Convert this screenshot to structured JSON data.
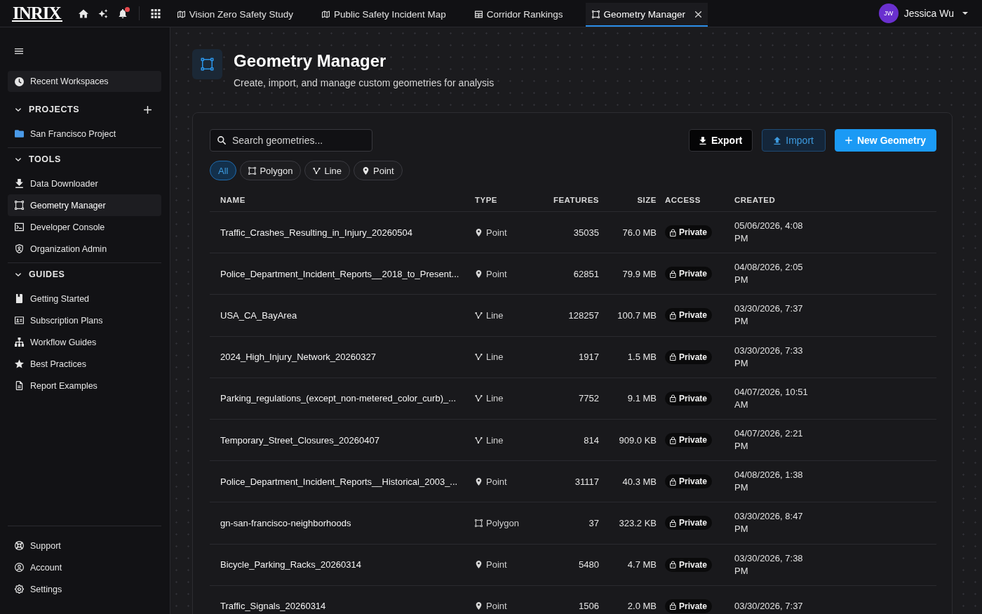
{
  "top_bar": {
    "logo": "INRIX",
    "notifications_unread": true,
    "tabs": [
      {
        "label": "Vision Zero Safety Study",
        "kind": "map",
        "selected": false,
        "closable": false
      },
      {
        "label": "Public Safety Incident Map",
        "kind": "map",
        "selected": false,
        "closable": false
      },
      {
        "label": "Corridor Rankings",
        "kind": "table",
        "selected": false,
        "closable": false
      },
      {
        "label": "Geometry Manager",
        "kind": "geometry",
        "selected": true,
        "closable": true
      }
    ],
    "user": {
      "initials": "JW",
      "name": "Jessica Wu"
    }
  },
  "sidebar": {
    "recent": {
      "label": "Recent Workspaces",
      "kind": "clock"
    },
    "sections": [
      {
        "title": "PROJECTS",
        "expanded": true,
        "add_button": true,
        "items": [
          {
            "label": "San Francisco Project",
            "kind": "folder",
            "selected": false
          }
        ]
      },
      {
        "title": "TOOLS",
        "expanded": true,
        "add_button": false,
        "items": [
          {
            "label": "Data Downloader",
            "kind": "download",
            "selected": false
          },
          {
            "label": "Geometry Manager",
            "kind": "geometry",
            "selected": true
          },
          {
            "label": "Developer Console",
            "kind": "terminal",
            "selected": false
          },
          {
            "label": "Organization Admin",
            "kind": "shield",
            "selected": false
          }
        ]
      },
      {
        "title": "GUIDES",
        "expanded": true,
        "add_button": false,
        "items": [
          {
            "label": "Getting Started",
            "kind": "book",
            "selected": false
          },
          {
            "label": "Subscription Plans",
            "kind": "card",
            "selected": false
          },
          {
            "label": "Workflow Guides",
            "kind": "hierarchy",
            "selected": false
          },
          {
            "label": "Best Practices",
            "kind": "star",
            "selected": false
          },
          {
            "label": "Report Examples",
            "kind": "document",
            "selected": false
          }
        ]
      }
    ],
    "footer_items": [
      {
        "label": "Support",
        "kind": "lifebuoy",
        "selected": false
      },
      {
        "label": "Account",
        "kind": "account",
        "selected": false
      },
      {
        "label": "Settings",
        "kind": "gear",
        "selected": false
      }
    ]
  },
  "header": {
    "title": "Geometry Manager",
    "subtitle": "Create, import, and manage custom geometries for analysis"
  },
  "toolbar": {
    "search": {
      "placeholder": "Search geometries..."
    },
    "buttons": [
      {
        "label": "Export",
        "kind": "export"
      },
      {
        "label": "Import",
        "kind": "import"
      },
      {
        "label": "New Geometry",
        "kind": "new"
      }
    ],
    "filters": [
      {
        "label": "All",
        "kind": "all",
        "selected": true
      },
      {
        "label": "Polygon",
        "kind": "polygon",
        "selected": false
      },
      {
        "label": "Line",
        "kind": "line",
        "selected": false
      },
      {
        "label": "Point",
        "kind": "point",
        "selected": false
      }
    ]
  },
  "table": {
    "columns": [
      "NAME",
      "TYPE",
      "FEATURES",
      "SIZE",
      "ACCESS",
      "CREATED"
    ],
    "rows": [
      {
        "name": "Traffic_Crashes_Resulting_in_Injury_20260504",
        "type": "Point",
        "kind": "point",
        "features": "35035",
        "size": "76.0 MB",
        "access": "Private",
        "created": "05/06/2026, 4:08 PM"
      },
      {
        "name": "Police_Department_Incident_Reports__2018_to_Present...",
        "type": "Point",
        "kind": "point",
        "features": "62851",
        "size": "79.9 MB",
        "access": "Private",
        "created": "04/08/2026, 2:05 PM"
      },
      {
        "name": "USA_CA_BayArea",
        "type": "Line",
        "kind": "line",
        "features": "128257",
        "size": "100.7 MB",
        "access": "Private",
        "created": "03/30/2026, 7:37 PM"
      },
      {
        "name": "2024_High_Injury_Network_20260327",
        "type": "Line",
        "kind": "line",
        "features": "1917",
        "size": "1.5 MB",
        "access": "Private",
        "created": "03/30/2026, 7:33 PM"
      },
      {
        "name": "Parking_regulations_(except_non-metered_color_curb)_...",
        "type": "Line",
        "kind": "line",
        "features": "7752",
        "size": "9.1 MB",
        "access": "Private",
        "created": "04/07/2026, 10:51 AM"
      },
      {
        "name": "Temporary_Street_Closures_20260407",
        "type": "Line",
        "kind": "line",
        "features": "814",
        "size": "909.0 KB",
        "access": "Private",
        "created": "04/07/2026, 2:21 PM"
      },
      {
        "name": "Police_Department_Incident_Reports__Historical_2003_...",
        "type": "Point",
        "kind": "point",
        "features": "31117",
        "size": "40.3 MB",
        "access": "Private",
        "created": "04/08/2026, 1:38 PM"
      },
      {
        "name": "gn-san-francisco-neighborhoods",
        "type": "Polygon",
        "kind": "polygon",
        "features": "37",
        "size": "323.2 KB",
        "access": "Private",
        "created": "03/30/2026, 8:47 PM"
      },
      {
        "name": "Bicycle_Parking_Racks_20260314",
        "type": "Point",
        "kind": "point",
        "features": "5480",
        "size": "4.7 MB",
        "access": "Private",
        "created": "03/30/2026, 7:38 PM"
      },
      {
        "name": "Traffic_Signals_20260314",
        "type": "Point",
        "kind": "point",
        "features": "1506",
        "size": "2.0 MB",
        "access": "Private",
        "created": "03/30/2026, 7:37"
      }
    ]
  }
}
